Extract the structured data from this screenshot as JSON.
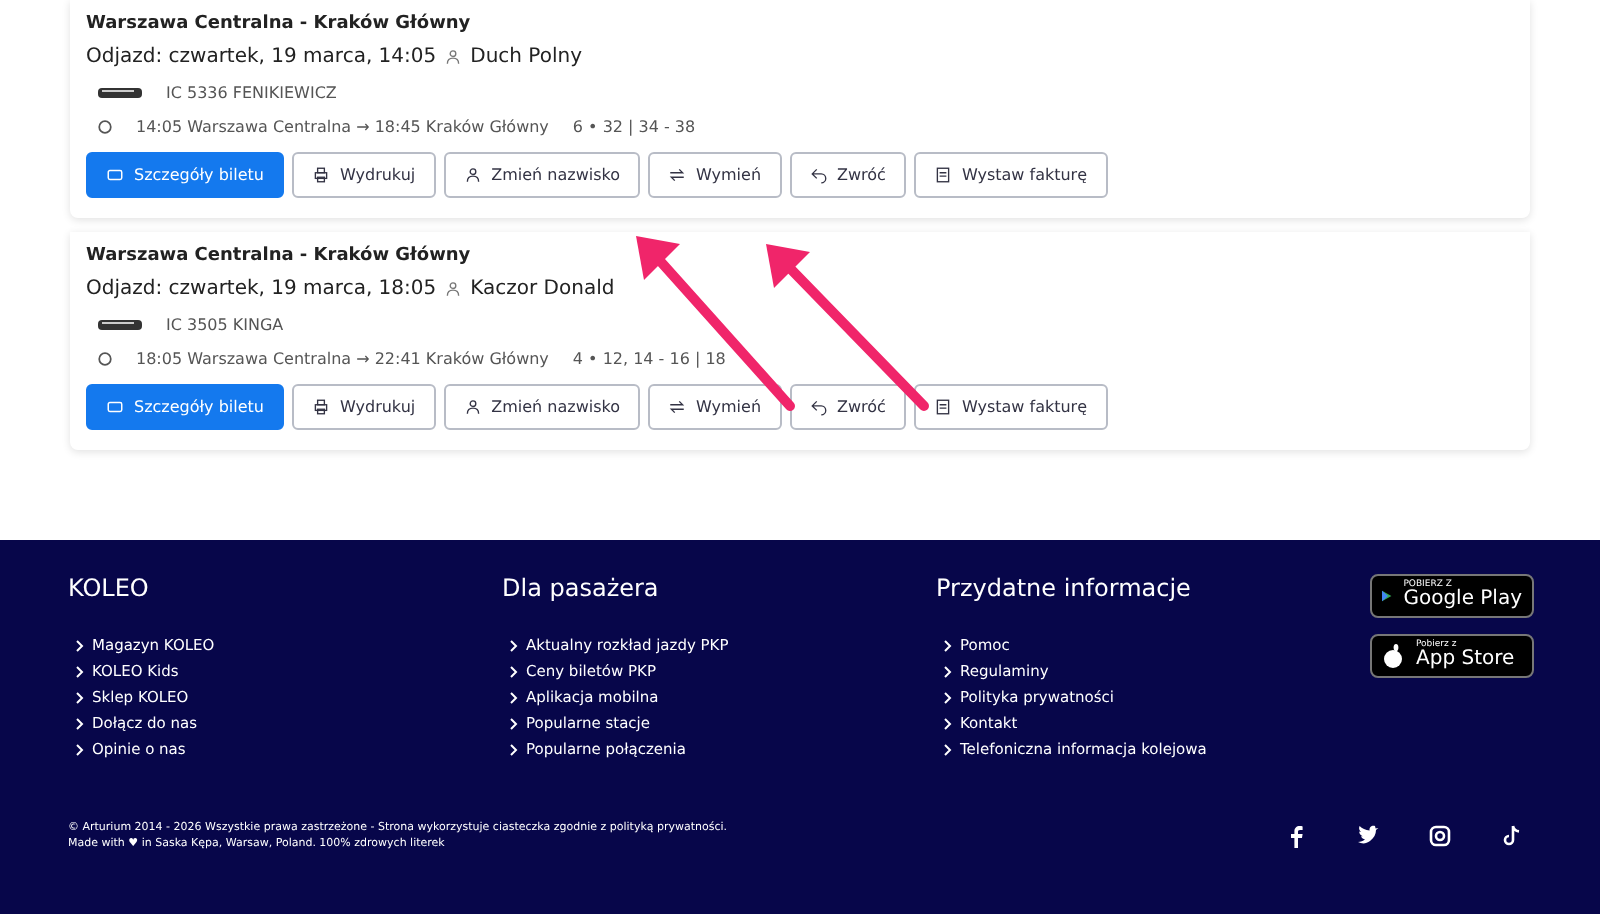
{
  "tickets": [
    {
      "route": "Warszawa Centralna - Kraków Główny",
      "departure": "Odjazd: czwartek, 19 marca, 14:05",
      "passenger": "Duch Polny",
      "train": "IC 5336 FENIKIEWICZ",
      "connection": "14:05 Warszawa Centralna → 18:45 Kraków Główny",
      "seats": "6 • 32 | 34 - 38",
      "buttons": [
        {
          "label": "Szczegóły biletu",
          "kind": "primary"
        },
        {
          "label": "Wydrukuj",
          "kind": "outline"
        },
        {
          "label": "Zmień nazwisko",
          "kind": "outline"
        },
        {
          "label": "Wymień",
          "kind": "outline"
        },
        {
          "label": "Zwróć",
          "kind": "outline"
        },
        {
          "label": "Wystaw fakturę",
          "kind": "outline"
        }
      ]
    },
    {
      "route": "Warszawa Centralna - Kraków Główny",
      "departure": "Odjazd: czwartek, 19 marca, 18:05",
      "passenger": "Kaczor Donald",
      "train": "IC 3505 KINGA",
      "connection": "18:05 Warszawa Centralna → 22:41 Kraków Główny",
      "seats": "4 • 12, 14 - 16 | 18",
      "buttons": [
        {
          "label": "Szczegóły biletu",
          "kind": "primary"
        },
        {
          "label": "Wydrukuj",
          "kind": "outline"
        },
        {
          "label": "Zmień nazwisko",
          "kind": "outline"
        },
        {
          "label": "Wymień",
          "kind": "outline"
        },
        {
          "label": "Zwróć",
          "kind": "outline"
        },
        {
          "label": "Wystaw fakturę",
          "kind": "outline"
        }
      ]
    }
  ],
  "annotation_arrows": [
    {
      "color": "#f0256a"
    },
    {
      "color": "#f0256a"
    }
  ],
  "footer": {
    "columns": [
      {
        "heading": "KOLEO",
        "links": [
          "Magazyn KOLEO",
          "KOLEO Kids",
          "Sklep KOLEO",
          "Dołącz do nas",
          "Opinie o nas"
        ]
      },
      {
        "heading": "Dla pasażera",
        "links": [
          "Aktualny rozkład jazdy PKP",
          "Ceny biletów PKP",
          "Aplikacja mobilna",
          "Popularne stacje",
          "Popularne połączenia"
        ]
      },
      {
        "heading": "Przydatne informacje",
        "links": [
          "Pomoc",
          "Regulaminy",
          "Polityka prywatności",
          "Kontakt",
          "Telefoniczna informacja kolejowa"
        ]
      }
    ],
    "stores": [
      {
        "kind": "google",
        "small": "POBIERZ Z",
        "big": "Google Play"
      },
      {
        "kind": "apple",
        "small": "Pobierz z",
        "big": "App Store"
      }
    ],
    "copyright": "© Arturium 2014 - 2026 Wszystkie prawa zastrzeżone - Strona wykorzystuje ciasteczka zgodnie z polityką prywatności.",
    "made_with": "Made with ♥ in Saska Kępa, Warsaw, Poland. 100% zdrowych literek"
  }
}
